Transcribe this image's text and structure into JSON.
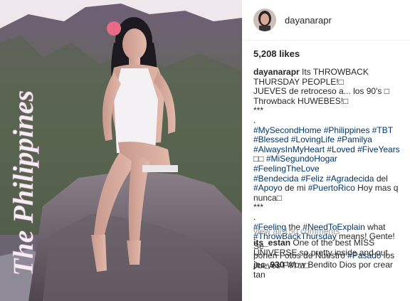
{
  "post": {
    "photo_text": "The Philippines",
    "username": "dayanarapr",
    "likes": "5,208 likes",
    "caption_lines": [
      {
        "parts": [
          {
            "t": "u",
            "v": "dayanarapr"
          },
          {
            "t": "x",
            "v": " Its THROWBACK THURSDAY PEOPLE!"
          },
          {
            "t": "x",
            "v": "□"
          }
        ]
      },
      {
        "parts": [
          {
            "t": "x",
            "v": "JUEVES de retroceso a... los 90's "
          },
          {
            "t": "x",
            "v": "□"
          }
        ]
      },
      {
        "parts": [
          {
            "t": "x",
            "v": "Throwback HUWEBES!"
          },
          {
            "t": "x",
            "v": "□"
          }
        ]
      },
      {
        "parts": [
          {
            "t": "x",
            "v": "***"
          }
        ]
      },
      {
        "parts": [
          {
            "t": "x",
            "v": "."
          }
        ]
      },
      {
        "parts": [
          {
            "t": "h",
            "v": "#MySecondHome"
          },
          {
            "t": "x",
            "v": " "
          },
          {
            "t": "h",
            "v": "#Philippines"
          },
          {
            "t": "x",
            "v": " "
          },
          {
            "t": "h",
            "v": "#TBT"
          }
        ]
      },
      {
        "parts": [
          {
            "t": "h",
            "v": "#Blessed"
          },
          {
            "t": "x",
            "v": " "
          },
          {
            "t": "h",
            "v": "#LovingLife"
          },
          {
            "t": "x",
            "v": " "
          },
          {
            "t": "h",
            "v": "#Pamilya"
          }
        ]
      },
      {
        "parts": [
          {
            "t": "h",
            "v": "#AlwaysInMyHeart"
          },
          {
            "t": "x",
            "v": " "
          },
          {
            "t": "h",
            "v": "#Loved"
          },
          {
            "t": "x",
            "v": " "
          },
          {
            "t": "h",
            "v": "#FiveYears"
          }
        ]
      },
      {
        "parts": [
          {
            "t": "x",
            "v": "□□ "
          },
          {
            "t": "h",
            "v": "#MiSegundoHogar"
          },
          {
            "t": "x",
            "v": " "
          },
          {
            "t": "h",
            "v": "#FeelingTheLove"
          }
        ]
      },
      {
        "parts": [
          {
            "t": "h",
            "v": "#Bendecida"
          },
          {
            "t": "x",
            "v": " "
          },
          {
            "t": "h",
            "v": "#Feliz"
          },
          {
            "t": "x",
            "v": " "
          },
          {
            "t": "h",
            "v": "#Agradecida"
          },
          {
            "t": "x",
            "v": " del"
          }
        ]
      },
      {
        "parts": [
          {
            "t": "h",
            "v": "#Apoyo"
          },
          {
            "t": "x",
            "v": " de mi "
          },
          {
            "t": "h",
            "v": "#PuertoRico"
          },
          {
            "t": "x",
            "v": " Hoy mas q"
          }
        ]
      },
      {
        "parts": [
          {
            "t": "x",
            "v": "nunca"
          },
          {
            "t": "x",
            "v": "□"
          }
        ]
      },
      {
        "parts": [
          {
            "t": "x",
            "v": "***"
          }
        ]
      },
      {
        "parts": [
          {
            "t": "x",
            "v": "."
          }
        ]
      },
      {
        "parts": [
          {
            "t": "h",
            "v": "#Feeling"
          },
          {
            "t": "x",
            "v": " the "
          },
          {
            "t": "h",
            "v": "#NeedToExplain"
          },
          {
            "t": "x",
            "v": " what"
          }
        ]
      },
      {
        "parts": [
          {
            "t": "h",
            "v": "#ThrowBackThursday"
          },
          {
            "t": "x",
            "v": " means! Gente! Se"
          }
        ]
      },
      {
        "parts": [
          {
            "t": "x",
            "v": "ponen Fotos de Nuestro "
          },
          {
            "t": "h",
            "v": "#Pasado"
          },
          {
            "t": "x",
            "v": " los"
          }
        ]
      },
      {
        "parts": [
          {
            "t": "x",
            "v": "Jueves FYI "
          },
          {
            "t": "x",
            "v": "□□"
          }
        ]
      }
    ],
    "view_all": "view all 150 comments",
    "comments": [
      {
        "user": "its_estan",
        "text": " One of the best MISS UNIVERSE so pretty inside and out"
      },
      {
        "user": "jec_930",
        "text": " Wow Bendito Dios por crear tan"
      }
    ]
  },
  "colors": {
    "hashtag": "#003569",
    "text": "#262626",
    "muted": "#999999",
    "divider": "#efefef"
  },
  "icons": [
    "flower-icon"
  ]
}
